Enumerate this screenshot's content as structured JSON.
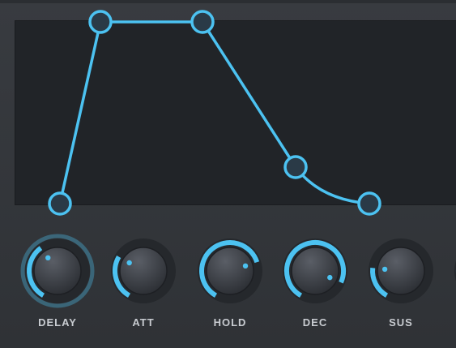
{
  "colors": {
    "accent": "#4cc2f1",
    "display_bg": "#212428",
    "panel_bg": "#35383d",
    "knob_track": "#25282c",
    "label": "#c9ccd1"
  },
  "envelope": {
    "handles": [
      "delay",
      "attack",
      "hold",
      "decay",
      "sustain"
    ]
  },
  "knobs": [
    {
      "id": "delay",
      "label": "DELAY",
      "value": 0.38,
      "focused": true
    },
    {
      "id": "att",
      "label": "ATT",
      "value": 0.3,
      "focused": false
    },
    {
      "id": "hold",
      "label": "HOLD",
      "value": 0.74,
      "focused": false
    },
    {
      "id": "dec",
      "label": "DEC",
      "value": 0.88,
      "focused": false
    },
    {
      "id": "sus",
      "label": "SUS",
      "value": 0.22,
      "focused": false
    }
  ]
}
